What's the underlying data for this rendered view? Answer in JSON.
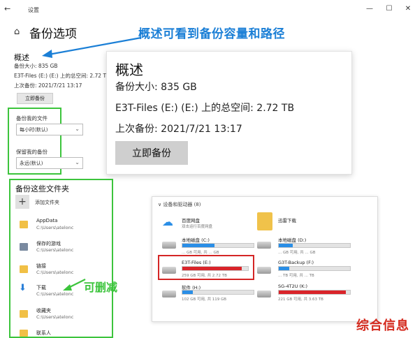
{
  "window": {
    "back": "←",
    "title": "设置",
    "minimize": "—",
    "maximize": "☐",
    "close": "✕"
  },
  "page": {
    "home_icon": "home-icon",
    "title": "备份选项"
  },
  "annotations": {
    "top": "概述可看到备份容量和路径",
    "delete": "可删减"
  },
  "overview": {
    "heading": "概述",
    "size": "备份大小: 835 GB",
    "total": "E3T-Files (E:) (E:) 上的总空间: 2.72 TB",
    "last": "上次备份: 2021/7/21 13:17",
    "button": "立即备份"
  },
  "settings": {
    "backup_freq_label": "备份我的文件",
    "backup_freq_value": "每小时(默认)",
    "keep_label": "保留我的备份",
    "keep_value": "永远(默认)"
  },
  "zoom": {
    "heading": "概述",
    "size": "备份大小: 835 GB",
    "total": "E3T-Files (E:) (E:) 上的总空间: 2.72 TB",
    "last": "上次备份: 2021/7/21 13:17",
    "button": "立即备份"
  },
  "folders": {
    "heading": "备份这些文件夹",
    "add_label": "添加文件夹",
    "items": [
      {
        "name": "AppData",
        "path": "C:\\Users\\atelonc"
      },
      {
        "name": "保存的游戏",
        "path": "C:\\Users\\atelonc"
      },
      {
        "name": "链接",
        "path": "C:\\Users\\atelonc"
      },
      {
        "name": "下载",
        "path": "C:\\Users\\atelonc"
      },
      {
        "name": "收藏夹",
        "path": "C:\\Users\\atelonc"
      },
      {
        "name": "联系人",
        "path": ""
      }
    ]
  },
  "explorer": {
    "heading": "∨ 设备和驱动器 (8)",
    "drives": [
      {
        "name": "百度网盘",
        "info": "双击运行百度网盘",
        "fill": 0,
        "color": "#2a8ee6"
      },
      {
        "name": "迅雷下载",
        "info": "",
        "fill": 0,
        "color": "#2a8ee6"
      },
      {
        "name": "本地磁盘 (C:)",
        "info": "... GB 可用, 共 ... GB",
        "fill": 0.45,
        "color": "#2a8ee6"
      },
      {
        "name": "本地磁盘 (D:)",
        "info": "... GB 可用, 共 ... GB",
        "fill": 0.2,
        "color": "#2a8ee6"
      },
      {
        "name": "E3T-Files (E:)",
        "info": "259 GB 可用, 共 2.72 TB",
        "fill": 0.9,
        "color": "#d9242a"
      },
      {
        "name": "G3T-Backup (F:)",
        "info": "... TB 可用, 共 ... TB",
        "fill": 0.15,
        "color": "#2a8ee6"
      },
      {
        "name": "软件 (H:)",
        "info": "102 GB 可用, 共 119 GB",
        "fill": 0.15,
        "color": "#2a8ee6"
      },
      {
        "name": "SG-4T2U (K:)",
        "info": "221 GB 可用, 共 3.63 TB",
        "fill": 0.94,
        "color": "#d9242a"
      }
    ]
  },
  "footer": {
    "logo": "综合信息"
  }
}
